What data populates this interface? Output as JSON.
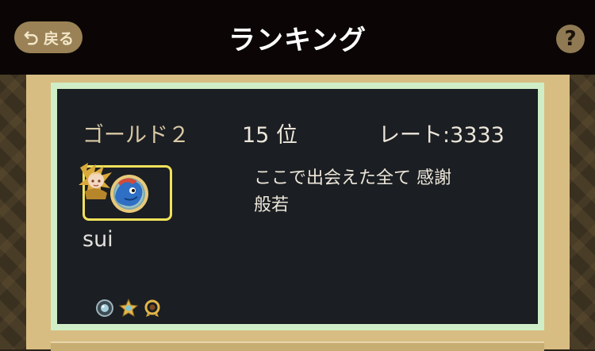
{
  "header": {
    "back_label": "戻る",
    "title": "ランキング",
    "help_label": "?"
  },
  "player": {
    "rank_name": "ゴールド２",
    "place": "15 位",
    "rate": "レート:3333",
    "username": "sui",
    "message": "ここで出会えた全て 感謝\n般若",
    "icons": {
      "character": "character-avatar-icon",
      "monster": "blue-monster-icon"
    },
    "badges": [
      "silver-orb-badge-icon",
      "gold-star-badge-icon",
      "gold-ring-badge-icon"
    ]
  },
  "colors": {
    "header_bg": "#0b0605",
    "card_bg": "#1b1e22",
    "card_border": "#cfeec7",
    "panel_bg": "#d8bd83",
    "frame_highlight": "#f0e25b"
  }
}
